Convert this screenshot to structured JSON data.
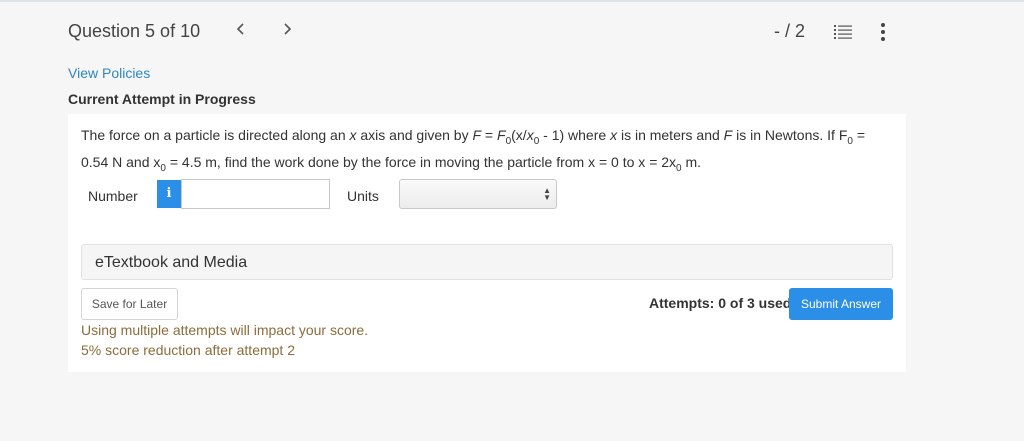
{
  "header": {
    "question_title": "Question 5 of 10",
    "prev_icon": "chevron-left-icon",
    "next_icon": "chevron-right-icon",
    "score": "- / 2",
    "list_icon": "list-icon",
    "more_icon": "more-vertical-icon"
  },
  "policies": {
    "view_policies": "View Policies",
    "attempt_title": "Current Attempt in Progress"
  },
  "question": {
    "p1": "The force on a particle is directed along an ",
    "x1": "x",
    "p2": " axis and given by ",
    "F1": "F",
    "p3": " = ",
    "F2": "F",
    "sub0a": "0",
    "p4": "(x/",
    "x2": "x",
    "sub0b": "0",
    "p5": " - 1) where ",
    "x3": "x",
    "p6": " is in meters and ",
    "F3": "F",
    "p7": " is in Newtons. If F",
    "sub0c": "0",
    "p8": " = 0.54 N and x",
    "sub0d": "0",
    "p9": " = 4.5 m, find the work done by the force in moving the particle from x = 0 to x = 2x",
    "sub0e": "0",
    "p10": " m."
  },
  "answer": {
    "number_label": "Number",
    "info_label": "i",
    "number_value": "",
    "units_label": "Units",
    "units_selected": ""
  },
  "etextbook": {
    "label": "eTextbook and Media"
  },
  "footer": {
    "save_label": "Save for Later",
    "attempts": "Attempts: 0 of 3 used",
    "submit_label": "Submit Answer",
    "warning1": "Using multiple attempts will impact your score.",
    "warning2": "5% score reduction after attempt 2"
  },
  "colors": {
    "accent": "#2b8fe8",
    "link": "#2f86c6",
    "warning": "#8a6d3b"
  }
}
